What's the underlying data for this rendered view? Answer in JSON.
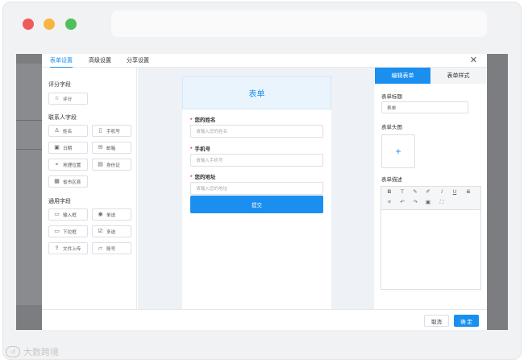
{
  "dialog": {
    "tabs": [
      "表单设置",
      "高级设置",
      "分享设置"
    ],
    "close_icon": "close-icon"
  },
  "left_panel": {
    "section_rating": "评分字段",
    "rating_fields": [
      {
        "icon": "star-icon",
        "label": "评分"
      }
    ],
    "section_contact": "联系人字段",
    "contact_fields": [
      {
        "icon": "user-icon",
        "label": "姓名"
      },
      {
        "icon": "phone-icon",
        "label": "手机号"
      },
      {
        "icon": "calendar-icon",
        "label": "日期"
      },
      {
        "icon": "mail-icon",
        "label": "邮箱"
      },
      {
        "icon": "location-icon",
        "label": "地理位置"
      },
      {
        "icon": "id-card-icon",
        "label": "身份证"
      },
      {
        "icon": "city-icon",
        "label": "省市区县"
      }
    ],
    "section_common": "通用字段",
    "common_fields": [
      {
        "icon": "input-icon",
        "label": "输入框"
      },
      {
        "icon": "radio-icon",
        "label": "单选"
      },
      {
        "icon": "dropdown-icon",
        "label": "下拉框"
      },
      {
        "icon": "checkbox-icon",
        "label": "多选"
      },
      {
        "icon": "upload-icon",
        "label": "文件上传"
      },
      {
        "icon": "number-icon",
        "label": "账号"
      }
    ]
  },
  "form": {
    "title": "表单",
    "questions": [
      {
        "required": "*",
        "label": "您的姓名",
        "placeholder": "请输入您的姓名"
      },
      {
        "required": "*",
        "label": "手机号",
        "placeholder": "请输入手机号"
      },
      {
        "required": "*",
        "label": "您的地址",
        "placeholder": "请输入您的地址"
      }
    ],
    "submit_label": "提交"
  },
  "right_panel": {
    "tab_edit": "编辑表单",
    "tab_style": "表单样式",
    "title_label": "表单标题",
    "title_value": "表单",
    "header_label": "表单头图",
    "upload_plus": "+",
    "desc_label": "表单描述",
    "toolbar_icons": [
      "bold-icon",
      "font-size-icon",
      "color-icon",
      "highlight-icon",
      "italic-icon",
      "underline-icon",
      "strikethrough-icon",
      "align-icon",
      "undo-icon",
      "redo-icon",
      "image-icon",
      "fullscreen-icon"
    ]
  },
  "footer": {
    "cancel_label": "取消",
    "ok_label": "确 定"
  },
  "watermark": {
    "text": "大数跨境"
  }
}
